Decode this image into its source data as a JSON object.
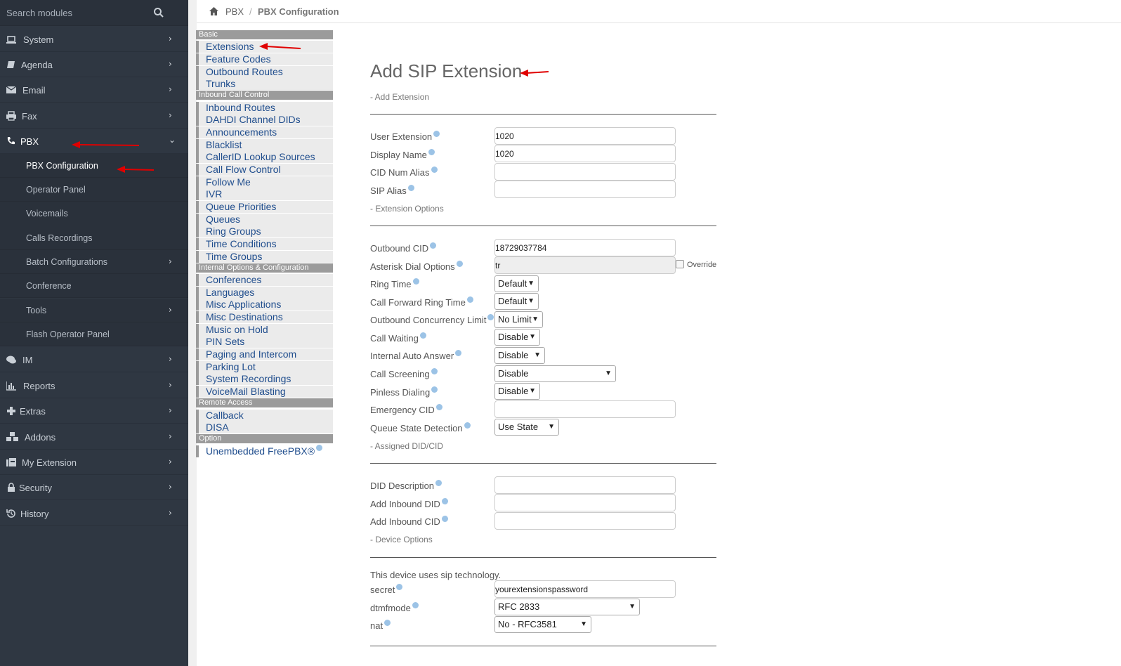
{
  "sidebar": {
    "search_placeholder": "Search modules",
    "items": [
      {
        "label": "System",
        "icon": "laptop-icon"
      },
      {
        "label": "Agenda",
        "icon": "book-icon"
      },
      {
        "label": "Email",
        "icon": "envelope-icon"
      },
      {
        "label": "Fax",
        "icon": "printer-icon"
      },
      {
        "label": "PBX",
        "icon": "phone-icon"
      },
      {
        "label": "IM",
        "icon": "chat-icon"
      },
      {
        "label": "Reports",
        "icon": "bar-chart-icon"
      },
      {
        "label": "Extras",
        "icon": "plus-icon"
      },
      {
        "label": "Addons",
        "icon": "cubes-icon"
      },
      {
        "label": "My Extension",
        "icon": "fax-icon"
      },
      {
        "label": "Security",
        "icon": "lock-icon"
      },
      {
        "label": "History",
        "icon": "history-icon"
      }
    ],
    "pbx_sub": [
      {
        "label": "PBX Configuration"
      },
      {
        "label": "Operator Panel"
      },
      {
        "label": "Voicemails"
      },
      {
        "label": "Calls Recordings"
      },
      {
        "label": "Batch Configurations"
      },
      {
        "label": "Conference"
      },
      {
        "label": "Tools"
      },
      {
        "label": "Flash Operator Panel"
      }
    ]
  },
  "breadcrumb": {
    "level1": "PBX",
    "separator": "/",
    "level2": "PBX Configuration"
  },
  "module_menu": {
    "basic_header": "Basic",
    "basic": [
      "Extensions",
      "Feature Codes",
      "Outbound Routes",
      "Trunks"
    ],
    "inbound_header": "Inbound Call Control",
    "inbound": [
      "Inbound Routes",
      "DAHDI Channel DIDs",
      "Announcements",
      "Blacklist",
      "CallerID Lookup Sources",
      "Call Flow Control",
      "Follow Me",
      "IVR",
      "Queue Priorities",
      "Queues",
      "Ring Groups",
      "Time Conditions",
      "Time Groups"
    ],
    "internal_header": "Internal Options & Configuration",
    "internal": [
      "Conferences",
      "Languages",
      "Misc Applications",
      "Misc Destinations",
      "Music on Hold",
      "PIN Sets",
      "Paging and Intercom",
      "Parking Lot",
      "System Recordings",
      "VoiceMail Blasting"
    ],
    "remote_header": "Remote Access",
    "remote": [
      "Callback",
      "DISA"
    ],
    "option_header": "Option",
    "option": [
      "Unembedded FreePBX®"
    ]
  },
  "form": {
    "title": "Add SIP Extension",
    "sec_add": "- Add Extension",
    "user_extension_label": "User Extension",
    "user_extension_value": "1020",
    "display_name_label": "Display Name",
    "display_name_value": "1020",
    "cid_num_alias_label": "CID Num Alias",
    "cid_num_alias_value": "",
    "sip_alias_label": "SIP Alias",
    "sip_alias_value": "",
    "sec_ext_options": "- Extension Options",
    "outbound_cid_label": "Outbound CID",
    "outbound_cid_value": "18729037784",
    "dial_options_label": "Asterisk Dial Options",
    "dial_options_value": "tr",
    "override_label": "Override",
    "ring_time_label": "Ring Time",
    "ring_time_value": "Default",
    "cf_ring_time_label": "Call Forward Ring Time",
    "cf_ring_time_value": "Default",
    "concurrency_label": "Outbound Concurrency Limit",
    "concurrency_value": "No Limit",
    "call_waiting_label": "Call Waiting",
    "call_waiting_value": "Disable",
    "auto_answer_label": "Internal Auto Answer",
    "auto_answer_value": "Disable",
    "call_screening_label": "Call Screening",
    "call_screening_value": "Disable",
    "pinless_label": "Pinless Dialing",
    "pinless_value": "Disable",
    "emergency_cid_label": "Emergency CID",
    "emergency_cid_value": "",
    "queue_state_label": "Queue State Detection",
    "queue_state_value": "Use State",
    "sec_assigned": "- Assigned DID/CID",
    "did_desc_label": "DID Description",
    "did_desc_value": "",
    "add_did_label": "Add Inbound DID",
    "add_did_value": "",
    "add_cid_label": "Add Inbound CID",
    "add_cid_value": "",
    "sec_device": "- Device Options",
    "device_note": "This device uses sip technology.",
    "secret_label": "secret",
    "secret_value": "yourextensionspassword",
    "dtmf_label": "dtmfmode",
    "dtmf_value": "RFC 2833",
    "nat_label": "nat",
    "nat_value": "No - RFC3581"
  },
  "colors": {
    "sidebar_bg": "#2f3742",
    "link": "#1f4d8d",
    "menu_header": "#9b9b9b",
    "annotation_arrow": "#e00000"
  }
}
